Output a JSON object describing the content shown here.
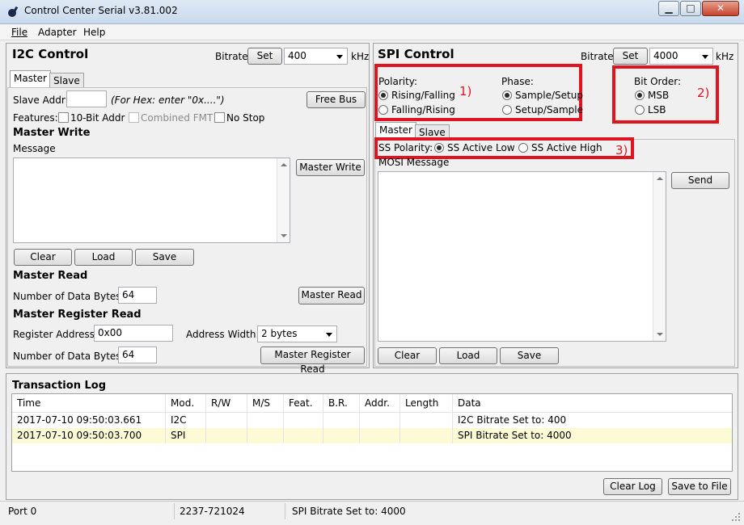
{
  "window": {
    "title": "Control Center Serial v3.81.002",
    "buttons": {
      "minimize": "▁",
      "maximize": "□",
      "close": "✕"
    }
  },
  "menu": {
    "file": "File",
    "adapter": "Adapter",
    "help": "Help"
  },
  "i2c": {
    "title": "I2C Control",
    "bitrate_label": "Bitrate",
    "set_label": "Set",
    "bitrate_value": "400",
    "unit": "kHz",
    "tabs": {
      "master": "Master",
      "slave": "Slave"
    },
    "slave_addr_label": "Slave Addr:",
    "slave_addr_value": "",
    "hex_hint": "(For Hex: enter \"0x....\")",
    "free_bus": "Free Bus",
    "features_label": "Features:",
    "feature_10bit": "10-Bit Addr",
    "feature_combined": "Combined FMT",
    "feature_nostop": "No Stop",
    "master_write_title": "Master Write",
    "message_label": "Message",
    "master_write_btn": "Master Write",
    "clear": "Clear",
    "load": "Load",
    "save": "Save",
    "master_read_title": "Master Read",
    "num_bytes_label": "Number of Data Bytes:",
    "num_bytes_value": "64",
    "master_read_btn": "Master Read",
    "master_reg_title": "Master Register Read",
    "reg_addr_label": "Register Address:",
    "reg_addr_value": "0x00",
    "addr_width_label": "Address Width:",
    "addr_width_value": "2 bytes",
    "num_bytes2_label": "Number of Data Bytes:",
    "num_bytes2_value": "64",
    "master_reg_btn": "Master Register Read"
  },
  "spi": {
    "title": "SPI Control",
    "bitrate_label": "Bitrate",
    "set_label": "Set",
    "bitrate_value": "4000",
    "unit": "kHz",
    "polarity_label": "Polarity:",
    "polarity_opt1": "Rising/Falling",
    "polarity_opt2": "Falling/Rising",
    "phase_label": "Phase:",
    "phase_opt1": "Sample/Setup",
    "phase_opt2": "Setup/Sample",
    "bitorder_label": "Bit Order:",
    "bitorder_opt1": "MSB",
    "bitorder_opt2": "LSB",
    "annot1": "1)",
    "annot2": "2)",
    "annot3": "3)",
    "tabs": {
      "master": "Master",
      "slave": "Slave"
    },
    "ss_polarity_label": "SS Polarity:",
    "ss_opt1": "SS Active Low",
    "ss_opt2": "SS Active High",
    "mosi_label": "MOSI Message",
    "send": "Send",
    "clear": "Clear",
    "load": "Load",
    "save": "Save"
  },
  "log": {
    "title": "Transaction Log",
    "columns": [
      "Time",
      "Mod.",
      "R/W",
      "M/S",
      "Feat.",
      "B.R.",
      "Addr.",
      "Length",
      "Data"
    ],
    "rows": [
      {
        "time": "2017-07-10 09:50:03.661",
        "mod": "I2C",
        "rw": "",
        "ms": "",
        "feat": "",
        "br": "",
        "addr": "",
        "length": "",
        "data": "I2C Bitrate Set to: 400"
      },
      {
        "time": "2017-07-10 09:50:03.700",
        "mod": "SPI",
        "rw": "",
        "ms": "",
        "feat": "",
        "br": "",
        "addr": "",
        "length": "",
        "data": "SPI Bitrate Set to: 4000"
      }
    ],
    "clear_log": "Clear Log",
    "save_to_file": "Save to File"
  },
  "status": {
    "port": "Port 0",
    "serial": "2237-721024",
    "message": "SPI Bitrate Set to: 4000"
  },
  "colors": {
    "highlight_red": "#e0141e",
    "selected_row": "#fdfbd6"
  }
}
